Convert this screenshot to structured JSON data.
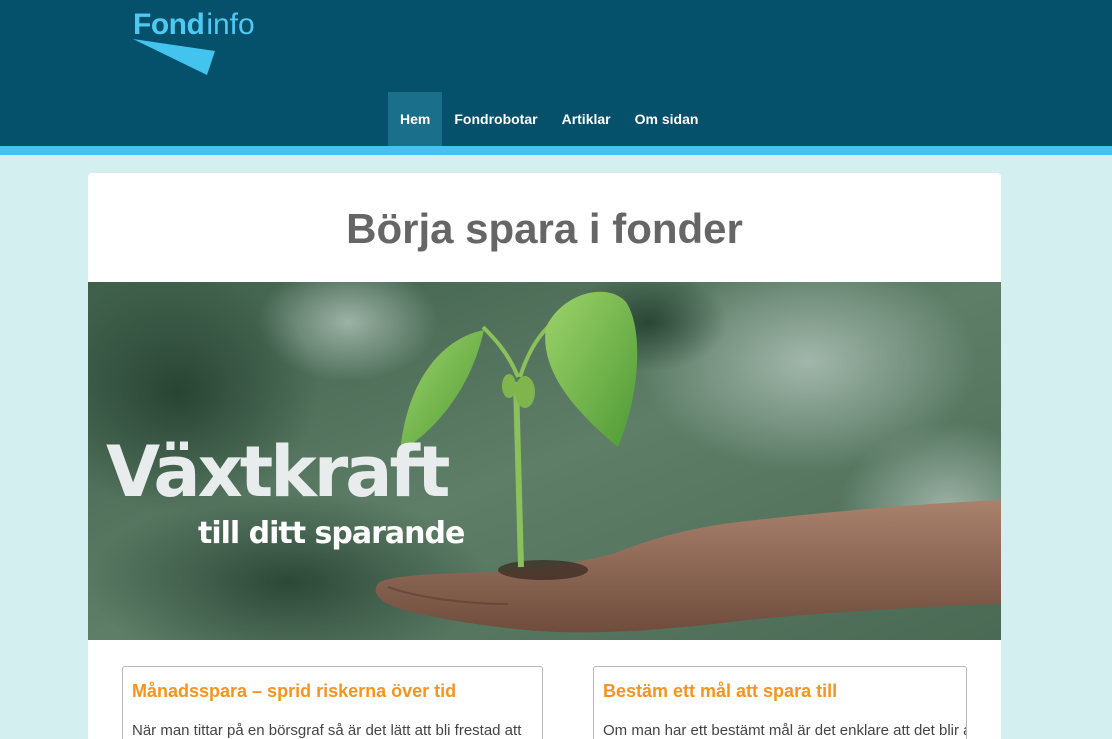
{
  "brand": {
    "logo_bold": "Fond",
    "logo_light": "info"
  },
  "nav": {
    "items": [
      {
        "label": "Hem",
        "active": true
      },
      {
        "label": "Fondrobotar",
        "active": false
      },
      {
        "label": "Artiklar",
        "active": false
      },
      {
        "label": "Om sidan",
        "active": false
      }
    ]
  },
  "main": {
    "title": "Börja spara i fonder",
    "hero": {
      "headline": "Växtkraft",
      "subline": "till ditt sparande"
    },
    "boxes": [
      {
        "title": "Månadsspara – sprid riskerna över tid",
        "text": "När man tittar på en börsgraf så är det lätt att bli frestad att"
      },
      {
        "title": "Bestäm ett mål att spara till",
        "text": "Om man har ett bestämt mål är det enklare att det blir av."
      }
    ]
  },
  "colors": {
    "header": "#05506a",
    "stripe": "#43c4ef",
    "page_background": "#d4eff0",
    "box_title": "#f7941d"
  }
}
